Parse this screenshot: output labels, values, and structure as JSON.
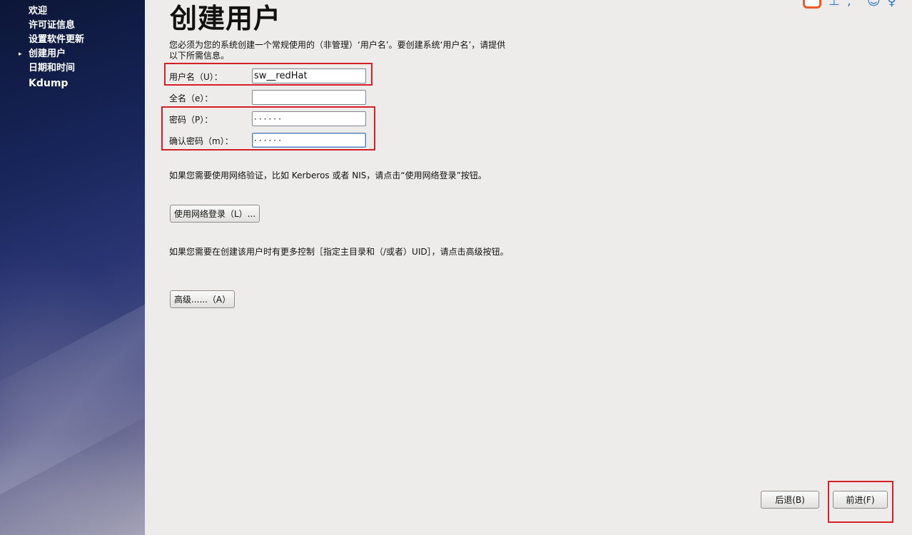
{
  "sidebar": {
    "items": [
      {
        "label": "欢迎",
        "current": false
      },
      {
        "label": "许可证信息",
        "current": false
      },
      {
        "label": "设置软件更新",
        "current": false
      },
      {
        "label": "创建用户",
        "current": true
      },
      {
        "label": "日期和时间",
        "current": false
      },
      {
        "label": "Kdump",
        "current": false
      }
    ],
    "current_marker": "▸"
  },
  "main": {
    "title": "创建用户",
    "intro": "您必须为您的系统创建一个常规使用的（非管理）‘用户名’。要创建系统‘用户名’，请提供以下所需信息。",
    "fields": {
      "username": {
        "label": "用户名（U）：",
        "value": "sw__redHat"
      },
      "fullname": {
        "label": "全名（e）：",
        "value": ""
      },
      "password": {
        "label": "密码（P）：",
        "value": "······"
      },
      "confirm": {
        "label": "确认密码（m）：",
        "value": "······"
      }
    },
    "network_text": "如果您需要使用网络验证，比如 Kerberos 或者 NIS，请点击“使用网络登录”按钮。",
    "network_button": "使用网络登录（L）...",
    "advanced_text": "如果您需要在创建该用户时有更多控制［指定主目录和（/或者）UID］，请点击高级按钮。",
    "advanced_button": "高级......（A）"
  },
  "footer": {
    "back_button": "后退(B)",
    "forward_button": "前进(F)"
  },
  "colors": {
    "highlight": "#d61f26",
    "background": "#edecea",
    "sidebar_top": "#0c1637",
    "sidebar_bottom": "#a8a7ba"
  }
}
